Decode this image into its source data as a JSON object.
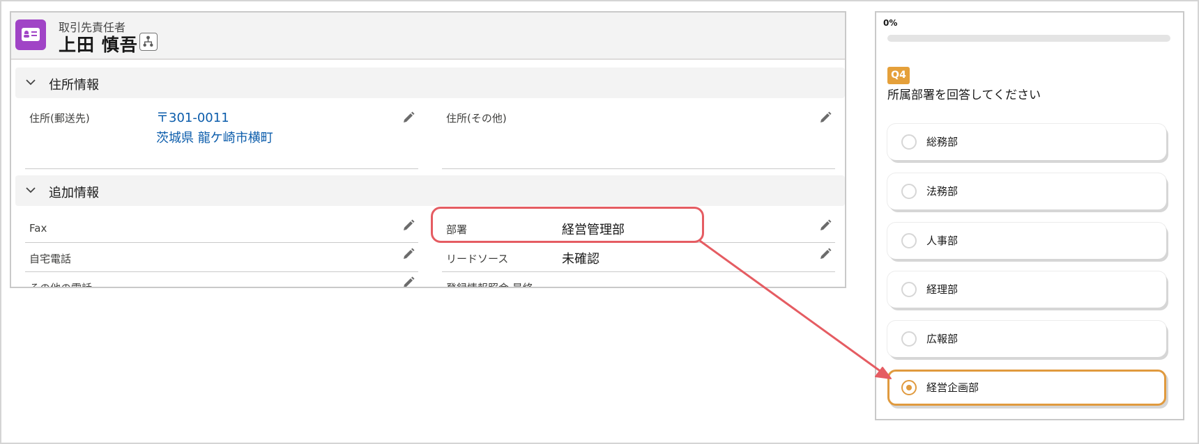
{
  "record": {
    "object_label": "取引先責任者",
    "name": "上田 慎吾",
    "icons": {
      "object": "contact-card-icon",
      "hierarchy": "hierarchy-icon"
    },
    "sections": {
      "address": {
        "title": "住所情報",
        "mailing_label": "住所(郵送先)",
        "mailing_line1": "〒301-0011",
        "mailing_line2": "茨城県 龍ケ崎市横町",
        "other_label": "住所(その他)"
      },
      "additional": {
        "title": "追加情報",
        "fax_label": "Fax",
        "home_phone_label": "自宅電話",
        "other_phone_label": "その他の電話",
        "department_label": "部署",
        "department_value": "経営管理部",
        "lead_source_label": "リードソース",
        "lead_source_value": "未確認",
        "registration_label": "登録情報照会 最終"
      }
    }
  },
  "survey": {
    "progress_text": "0%",
    "progress_value": 0,
    "question_badge": "Q4",
    "question_text": "所属部署を回答してください",
    "options": [
      {
        "label": "総務部",
        "selected": false
      },
      {
        "label": "法務部",
        "selected": false
      },
      {
        "label": "人事部",
        "selected": false
      },
      {
        "label": "経理部",
        "selected": false
      },
      {
        "label": "広報部",
        "selected": false
      },
      {
        "label": "経営企画部",
        "selected": true
      }
    ]
  },
  "colors": {
    "object_icon": "#a044c6",
    "link": "#0b5cab",
    "callout": "#e55c62",
    "accent": "#e09a3e"
  }
}
